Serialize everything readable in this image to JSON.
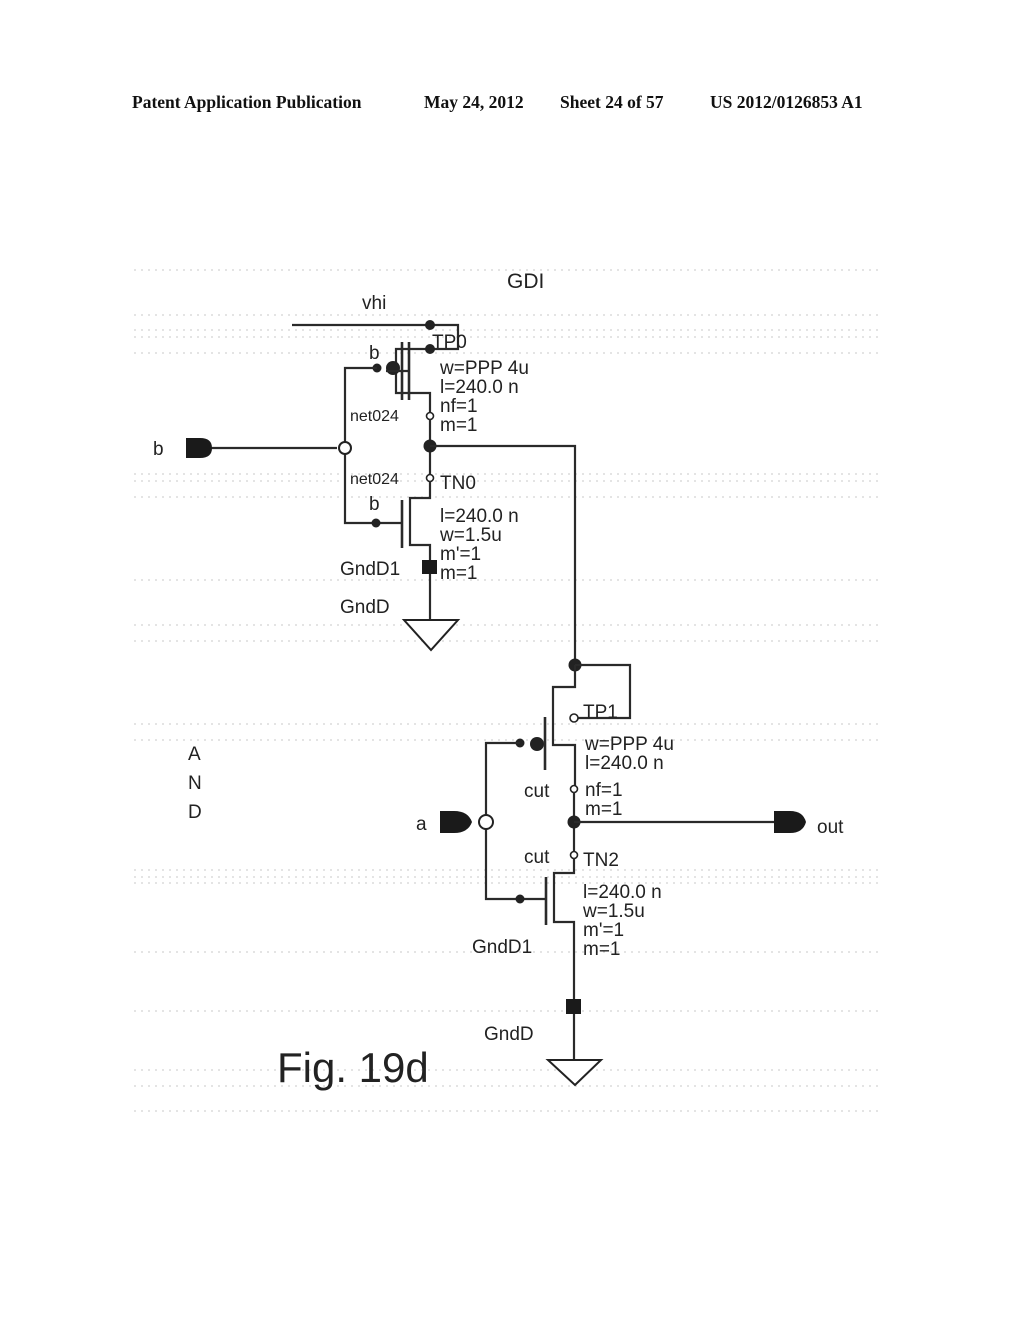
{
  "header": {
    "publication": "Patent Application Publication",
    "date": "May 24, 2012",
    "sheet": "Sheet 24 of 57",
    "number": "US 2012/0126853 A1"
  },
  "figure": {
    "caption": "Fig. 19d",
    "title": "GDI",
    "side_label": [
      "A",
      "N",
      "D"
    ],
    "supply_net": "vhi",
    "pins": {
      "input_b": "b",
      "input_a": "a",
      "output": "out"
    },
    "transistors": {
      "TP0": {
        "name": "TP0",
        "gate_net": "b",
        "params": [
          "w=PPP 4u",
          "l=240.0 n",
          "nf=1",
          "m=1"
        ],
        "node_label": "net024"
      },
      "TN0": {
        "name": "TN0",
        "gate_net": "b",
        "params": [
          "l=240.0 n",
          "w=1.5u",
          "m'=1",
          "m=1"
        ],
        "node_label": "net024",
        "bulk_label": "GndD1",
        "ground_label": "GndD"
      },
      "TP1": {
        "name": "TP1",
        "params": [
          "w=PPP 4u",
          "l=240.0 n",
          "nf=1",
          "m=1"
        ],
        "node_label": "cut"
      },
      "TN2": {
        "name": "TN2",
        "params": [
          "l=240.0 n",
          "w=1.5u",
          "m'=1",
          "m=1"
        ],
        "node_label": "cut",
        "bulk_label": "GndD1",
        "ground_label": "GndD"
      }
    }
  }
}
